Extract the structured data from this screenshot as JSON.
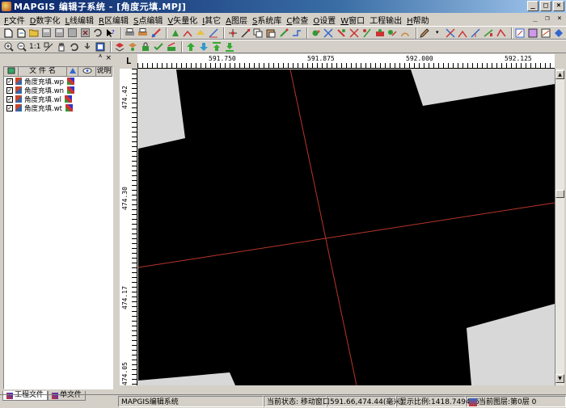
{
  "window": {
    "title": "MAPGIS 编辑子系统 - [角度元填.MPJ]",
    "controls": {
      "minimize": "_",
      "maximize": "□",
      "close": "×"
    }
  },
  "menubar": {
    "items": [
      {
        "accel": "F",
        "label": "文件"
      },
      {
        "accel": "D",
        "label": "数字化"
      },
      {
        "accel": "L",
        "label": "线编辑"
      },
      {
        "accel": "R",
        "label": "区编辑"
      },
      {
        "accel": "S",
        "label": "点编辑"
      },
      {
        "accel": "V",
        "label": "矢量化"
      },
      {
        "accel": "I",
        "label": "其它"
      },
      {
        "accel": "A",
        "label": "图层"
      },
      {
        "accel": "S",
        "label": "系统库"
      },
      {
        "accel": "C",
        "label": "检查"
      },
      {
        "accel": "O",
        "label": "设置"
      },
      {
        "accel": "W",
        "label": "窗口"
      },
      {
        "accel": "",
        "label": "工程输出"
      },
      {
        "accel": "H",
        "label": "帮助"
      }
    ],
    "mdi_controls": {
      "minimize": "_",
      "restore": "❐",
      "close": "×"
    }
  },
  "toolbar2": {
    "zoom_label": "1:1"
  },
  "left_panel": {
    "autohide": "ᴬ",
    "close": "×",
    "columns": [
      "",
      "文 件 名",
      "",
      "",
      "说明"
    ],
    "files": [
      {
        "name": "角度充填.wp",
        "checked": "✓"
      },
      {
        "name": "角度充填.wn",
        "checked": "✓"
      },
      {
        "name": "角度充填.wl",
        "checked": "✓"
      },
      {
        "name": "角度充填.wt",
        "checked": "✓"
      }
    ],
    "tabs": [
      "工程文件",
      "单文件"
    ]
  },
  "ruler": {
    "corner": "L",
    "x_labels": [
      "591.750",
      "591.875",
      "592.000",
      "592.125"
    ],
    "y_labels": [
      "474.42",
      "474.30",
      "474.17",
      "474.05"
    ]
  },
  "statusbar": {
    "app_name": "MAPGIS编辑系统",
    "state_label": "当前状态:",
    "state_value": "移动窗口",
    "coords": "591.66,474.44(毫米)",
    "scale": "显示比例:1418.749485",
    "layer": "当前图层:第0层 0"
  },
  "colors": {
    "accent": "#0a246a",
    "map_bg": "#000000",
    "grid_line": "#c0392b"
  }
}
